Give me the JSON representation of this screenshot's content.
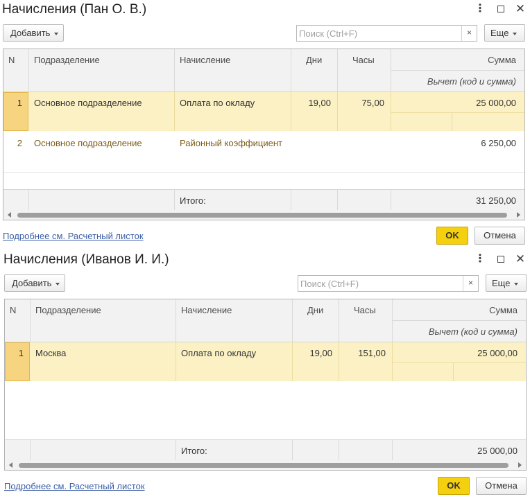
{
  "windows": [
    {
      "title": "Начисления (Пан О. В.)",
      "toolbar": {
        "add_label": "Добавить",
        "search_placeholder": "Поиск (Ctrl+F)",
        "clear_label": "×",
        "more_label": "Еще"
      },
      "columns": {
        "n": "N",
        "department": "Подразделение",
        "accrual": "Начисление",
        "days": "Дни",
        "hours": "Часы",
        "sum": "Сумма",
        "deduction": "Вычет (код и сумма)"
      },
      "rows": [
        {
          "n": "1",
          "department": "Основное подразделение",
          "accrual": "Оплата по окладу",
          "days": "19,00",
          "hours": "75,00",
          "sum": "25 000,00"
        },
        {
          "n": "2",
          "department": "Основное подразделение",
          "accrual": "Районный коэффициент",
          "days": "",
          "hours": "",
          "sum": "6 250,00"
        }
      ],
      "total_label": "Итого:",
      "total_value": "31 250,00",
      "link_label": "Подробнее см. Расчетный листок",
      "ok_label": "OK",
      "cancel_label": "Отмена"
    },
    {
      "title": "Начисления (Иванов И. И.)",
      "toolbar": {
        "add_label": "Добавить",
        "search_placeholder": "Поиск (Ctrl+F)",
        "clear_label": "×",
        "more_label": "Еще"
      },
      "columns": {
        "n": "N",
        "department": "Подразделение",
        "accrual": "Начисление",
        "days": "Дни",
        "hours": "Часы",
        "sum": "Сумма",
        "deduction": "Вычет (код и сумма)"
      },
      "rows": [
        {
          "n": "1",
          "department": "Москва",
          "accrual": "Оплата по окладу",
          "days": "19,00",
          "hours": "151,00",
          "sum": "25 000,00"
        }
      ],
      "total_label": "Итого:",
      "total_value": "25 000,00",
      "link_label": "Подробнее см. Расчетный листок",
      "ok_label": "OK",
      "cancel_label": "Отмена"
    }
  ],
  "icons": {
    "more": "more-vertical-icon",
    "maximize": "maximize-icon",
    "close": "close-icon",
    "dropdown": "caret-down-icon"
  },
  "colors": {
    "selected_row": "#fbf1c4",
    "current_cell": "#f7d47f",
    "ok_button": "#f5d00f",
    "link": "#3a5ea6",
    "secondary_row_text": "#7a5a16"
  }
}
